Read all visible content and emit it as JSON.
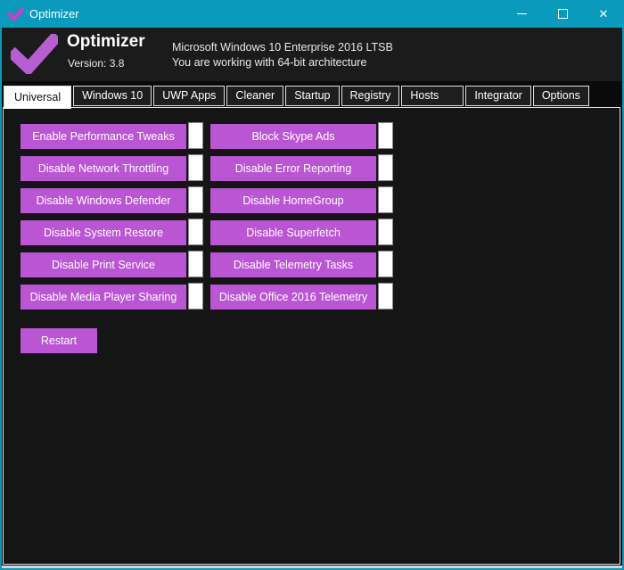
{
  "titlebar": {
    "title": "Optimizer",
    "close_glyph": "✕",
    "icons": {
      "logo": "check-icon",
      "minimize": "minimize-icon",
      "maximize": "maximize-icon",
      "close": "close-icon"
    }
  },
  "header": {
    "app_name": "Optimizer",
    "version": "Version: 3.8",
    "os_line1": "Microsoft Windows 10 Enterprise 2016 LTSB",
    "os_line2": "You are working with 64-bit architecture"
  },
  "tabs": {
    "selected": "Universal",
    "items": [
      "Universal",
      "Windows 10",
      "UWP Apps",
      "Cleaner",
      "Startup",
      "Registry",
      "Hosts",
      "Integrator",
      "Options"
    ]
  },
  "universal": {
    "left_buttons": [
      "Enable Performance Tweaks",
      "Disable Network Throttling",
      "Disable Windows Defender",
      "Disable System Restore",
      "Disable Print Service",
      "Disable Media Player Sharing"
    ],
    "right_buttons": [
      "Block Skype Ads",
      "Disable Error Reporting",
      "Disable HomeGroup",
      "Disable Superfetch",
      "Disable Telemetry Tasks",
      "Disable Office 2016 Telemetry"
    ],
    "restart_label": "Restart"
  },
  "colors": {
    "accent_teal": "#0a9abc",
    "button_purple": "#ba55d3",
    "titlebar_icon_pink": "#c93fc9",
    "header_bg": "#1b1b1b",
    "panel_bg": "#151515",
    "indicator_white": "#ffffff"
  }
}
